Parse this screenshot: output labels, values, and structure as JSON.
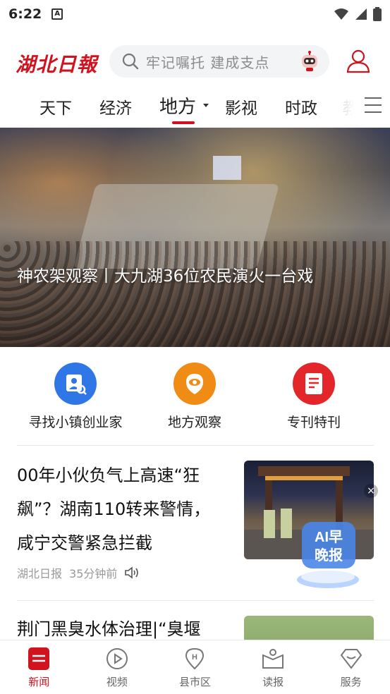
{
  "status_bar": {
    "time": "6:22",
    "notification_icon": "A"
  },
  "header": {
    "logo_text": "湖北日報",
    "search_placeholder": "牢记嘱托 建成支点"
  },
  "tabs": [
    {
      "label": "天下",
      "active": false
    },
    {
      "label": "经济",
      "active": false
    },
    {
      "label": "地方",
      "active": true
    },
    {
      "label": "影视",
      "active": false
    },
    {
      "label": "时政",
      "active": false
    },
    {
      "label": "教",
      "active": false
    }
  ],
  "hero": {
    "title": "神农架观察丨大九湖36位农民演火一台戏"
  },
  "shortcuts": [
    {
      "label": "寻找小镇创业家",
      "icon": "entrepreneur-icon",
      "color": "#2f76e6"
    },
    {
      "label": "地方观察",
      "icon": "eye-icon",
      "color": "#f08b16"
    },
    {
      "label": "专刊特刊",
      "icon": "document-icon",
      "color": "#e2262a"
    }
  ],
  "news": [
    {
      "headline": "00年小伙负气上高速“狂飙”？湖南110转来警情，咸宁交警紧急拦截",
      "source": "湖北日报",
      "time": "35分钟前"
    },
    {
      "headline": "荆门黑臭水体治理|“臭堰",
      "source": "",
      "time": ""
    }
  ],
  "ai_badge": {
    "text": "AI早晚报"
  },
  "bottom_nav": [
    {
      "label": "新闻",
      "icon": "news-icon",
      "active": true
    },
    {
      "label": "视频",
      "icon": "video-icon",
      "active": false
    },
    {
      "label": "县市区",
      "icon": "location-icon",
      "active": false
    },
    {
      "label": "读报",
      "icon": "newspaper-icon",
      "active": false
    },
    {
      "label": "服务",
      "icon": "service-icon",
      "active": false
    }
  ],
  "colors": {
    "brand_red": "#d0131e"
  }
}
